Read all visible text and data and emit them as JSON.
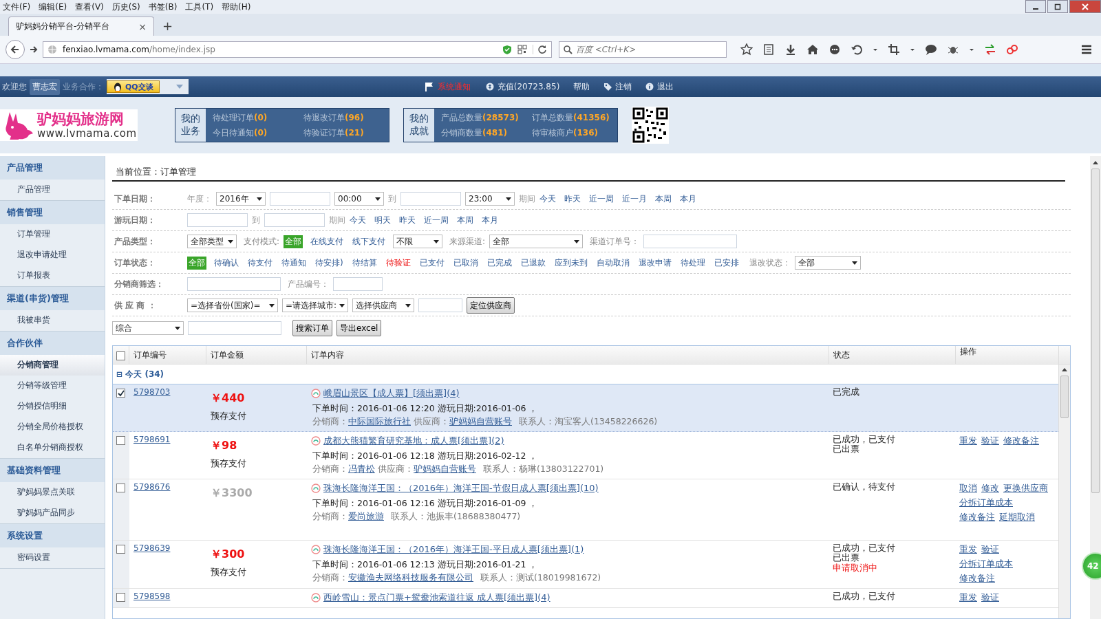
{
  "browser": {
    "menu": [
      "文件(F)",
      "编辑(E)",
      "查看(V)",
      "历史(S)",
      "书签(B)",
      "工具(T)",
      "帮助(H)"
    ],
    "tab": {
      "title": "驴妈妈分销平台-分销平台",
      "close": "×",
      "new": "+"
    },
    "url_host": "fenxiao.lvmama.com",
    "url_path": "/home/index.jsp",
    "search_placeholder": "百度 <Ctrl+K>"
  },
  "topbar": {
    "welcome": "欢迎您",
    "user": "曹志宏",
    "coop_label": "业务合作：",
    "qq_button": "QQ交谈",
    "notice": "系统通知",
    "links": [
      {
        "kind": "coin",
        "label": "充值(20723.85)"
      },
      {
        "kind": "none",
        "label": "帮助"
      },
      {
        "kind": "tag",
        "label": "注销"
      },
      {
        "kind": "info",
        "label": "退出"
      }
    ]
  },
  "logo": {
    "name": "驴妈妈旅游网",
    "url": "www.lvmama.com"
  },
  "panels": [
    {
      "title": [
        "我的",
        "业务"
      ],
      "items": [
        {
          "label": "待处理订单",
          "count": "(0)"
        },
        {
          "label": "待退改订单",
          "count": "(96)"
        },
        {
          "label": "今日待通知",
          "count": "(0)"
        },
        {
          "label": "待验证订单",
          "count": "(21)"
        }
      ]
    },
    {
      "title": [
        "我的",
        "成就"
      ],
      "items": [
        {
          "label": "产品总数量",
          "count": "(28573)"
        },
        {
          "label": "订单总数量",
          "count": "(41356)"
        },
        {
          "label": "分销商数量",
          "count": "(481)"
        },
        {
          "label": "待审核商户",
          "count": "(136)"
        }
      ]
    }
  ],
  "sidebar": [
    {
      "title": "产品管理",
      "items": [
        {
          "label": "产品管理",
          "selected": false
        }
      ]
    },
    {
      "title": "销售管理",
      "items": [
        {
          "label": "订单管理",
          "selected": false
        },
        {
          "label": "退改申请处理",
          "selected": false
        },
        {
          "label": "订单报表",
          "selected": false
        }
      ]
    },
    {
      "title": "渠道(串货)管理",
      "items": [
        {
          "label": "我被串货",
          "selected": false
        }
      ]
    },
    {
      "title": "合作伙伴",
      "items": [
        {
          "label": "分销商管理",
          "selected": true
        },
        {
          "label": "分销等级管理",
          "selected": false
        },
        {
          "label": "分销授信明细",
          "selected": false
        },
        {
          "label": "分销全局价格授权",
          "selected": false
        },
        {
          "label": "白名单分销商授权",
          "selected": false
        }
      ]
    },
    {
      "title": "基础资料管理",
      "items": [
        {
          "label": "驴妈妈景点关联",
          "selected": false
        },
        {
          "label": "驴妈妈产品同步",
          "selected": false
        }
      ]
    },
    {
      "title": "系统设置",
      "items": [
        {
          "label": "密码设置",
          "selected": false
        }
      ]
    }
  ],
  "breadcrumb": "当前位置：订单管理",
  "filters": {
    "order_date": {
      "label": "下单日期：",
      "year_label": "年度：",
      "year": "2016年",
      "from_time": "00:00",
      "to": "到",
      "to_time": "23:00",
      "period": "期间",
      "quick": [
        "今天",
        "昨天",
        "近一周",
        "近一月",
        "本周",
        "本月"
      ]
    },
    "play_date": {
      "label": "游玩日期：",
      "to": "到",
      "period": "期间",
      "quick": [
        "今天",
        "明天",
        "昨天",
        "近一周",
        "本周",
        "本月"
      ]
    },
    "product": {
      "label": "产品类型：",
      "type": "全部类型",
      "pay_label": "支付模式:",
      "pay_options": [
        {
          "label": "全部",
          "selected": true
        },
        {
          "label": "在线支付",
          "selected": false
        },
        {
          "label": "线下支付",
          "selected": false
        }
      ],
      "limit": "不限",
      "source_label": "来源渠道:",
      "source": "全部",
      "channel_label": "渠道订单号："
    },
    "status": {
      "label": "订单状态：",
      "options": [
        {
          "label": "全部",
          "selected": true,
          "alert": false
        },
        {
          "label": "待确认",
          "selected": false,
          "alert": false
        },
        {
          "label": "待支付",
          "selected": false,
          "alert": false
        },
        {
          "label": "待通知",
          "selected": false,
          "alert": false
        },
        {
          "label": "待安排)",
          "selected": false,
          "alert": false
        },
        {
          "label": "待结算",
          "selected": false,
          "alert": false
        },
        {
          "label": "待验证",
          "selected": false,
          "alert": true
        },
        {
          "label": "已支付",
          "selected": false,
          "alert": false
        },
        {
          "label": "已取消",
          "selected": false,
          "alert": false
        },
        {
          "label": "已完成",
          "selected": false,
          "alert": false
        },
        {
          "label": "已退款",
          "selected": false,
          "alert": false
        },
        {
          "label": "应到未到",
          "selected": false,
          "alert": false
        },
        {
          "label": "自动取消",
          "selected": false,
          "alert": false
        },
        {
          "label": "退改申请",
          "selected": false,
          "alert": false
        },
        {
          "label": "待处理",
          "selected": false,
          "alert": false
        },
        {
          "label": "已安排",
          "selected": false,
          "alert": false
        }
      ],
      "refund_label": "退改状态：",
      "refund": "全部"
    },
    "distributor": {
      "label": "分销商筛选：",
      "product_no_label": "产品编号："
    },
    "supplier": {
      "label": "供 应 商 ：",
      "province": "=选择省份(国家)=",
      "city": "=请选择城市:",
      "supplier": "选择供应商",
      "locate_button": "定位供应商"
    },
    "search": {
      "mode": "综合",
      "search_button": "搜索订单",
      "export_button": "导出excel"
    }
  },
  "table": {
    "all_checked": false,
    "columns": [
      "订单编号",
      "订单金额",
      "订单内容",
      "状态",
      "操作"
    ],
    "group": {
      "expander": "⊟",
      "label": "今天 (34)"
    },
    "rows": [
      {
        "selected": true,
        "checked": true,
        "id": "5798703",
        "amount": "￥440",
        "paid": true,
        "pay": "预存支付",
        "title": "峨眉山景区【成人票】[须出票](4)",
        "time": "下单时间：2016-01-06 12:20  游玩日期:2016-01-06 ，",
        "parties": [
          {
            "label": "分销商：",
            "name": "中际国际旅行社"
          },
          {
            "label": "供应商：",
            "name": "驴妈妈自营账号"
          }
        ],
        "contact": "联系人：淘宝客人(13458226626)",
        "status": [
          "已完成"
        ]
      },
      {
        "selected": false,
        "checked": false,
        "id": "5798691",
        "amount": "￥98",
        "paid": true,
        "pay": "预存支付",
        "title": "成都大熊猫繁育研究基地：成人票[须出票](2)",
        "time": "下单时间：2016-01-06 12:18  游玩日期:2016-02-12 ，",
        "parties": [
          {
            "label": "分销商：",
            "name": "冯青松"
          },
          {
            "label": "供应商：",
            "name": "驴妈妈自营账号"
          }
        ],
        "contact": "联系人：杨琳(13803122701)",
        "status": [
          "已成功，已支付",
          "已出票"
        ],
        "actions": [
          "重发",
          "验证",
          "修改备注"
        ]
      },
      {
        "selected": false,
        "checked": false,
        "id": "5798676",
        "amount": "￥3300",
        "paid": false,
        "title": "珠海长隆海洋王国：（2016年）海洋王国-节假日成人票[须出票](10)",
        "time": "下单时间：2016-01-06 12:16  游玩日期:2016-01-09 ，",
        "parties": [
          {
            "label": "分销商：",
            "name": "爱尚旅游"
          }
        ],
        "contact": "联系人：池振丰(18688380477)",
        "status": [
          "已确认，待支付"
        ],
        "actions": [
          "取消",
          "修改",
          "更换供应商",
          "分拆订单成本",
          "修改备注",
          "延期取消"
        ]
      },
      {
        "selected": false,
        "checked": false,
        "id": "5798639",
        "amount": "￥300",
        "paid": true,
        "pay": "预存支付",
        "title": "珠海长隆海洋王国：（2016年）海洋王国-平日成人票[须出票](1)",
        "time": "下单时间：2016-01-06 12:13  游玩日期:2016-01-21 ，",
        "parties": [
          {
            "label": "分销商：",
            "name": "安徽渔夫网络科技服务有限公司"
          }
        ],
        "contact": "联系人：测试(18019981672)",
        "status": [
          "已成功，已支付",
          "已出票"
        ],
        "alert": "申请取消中",
        "actions": [
          "重发",
          "验证",
          "分拆订单成本",
          "修改备注"
        ]
      },
      {
        "selected": false,
        "checked": false,
        "id": "5798598",
        "title": "西岭雪山：景点门票+鸳鸯池索道往返 成人票[须出票](4)",
        "status": [
          "已成功，已支付"
        ],
        "actions": [
          "重发",
          "验证"
        ]
      }
    ]
  },
  "float_badge": "42"
}
